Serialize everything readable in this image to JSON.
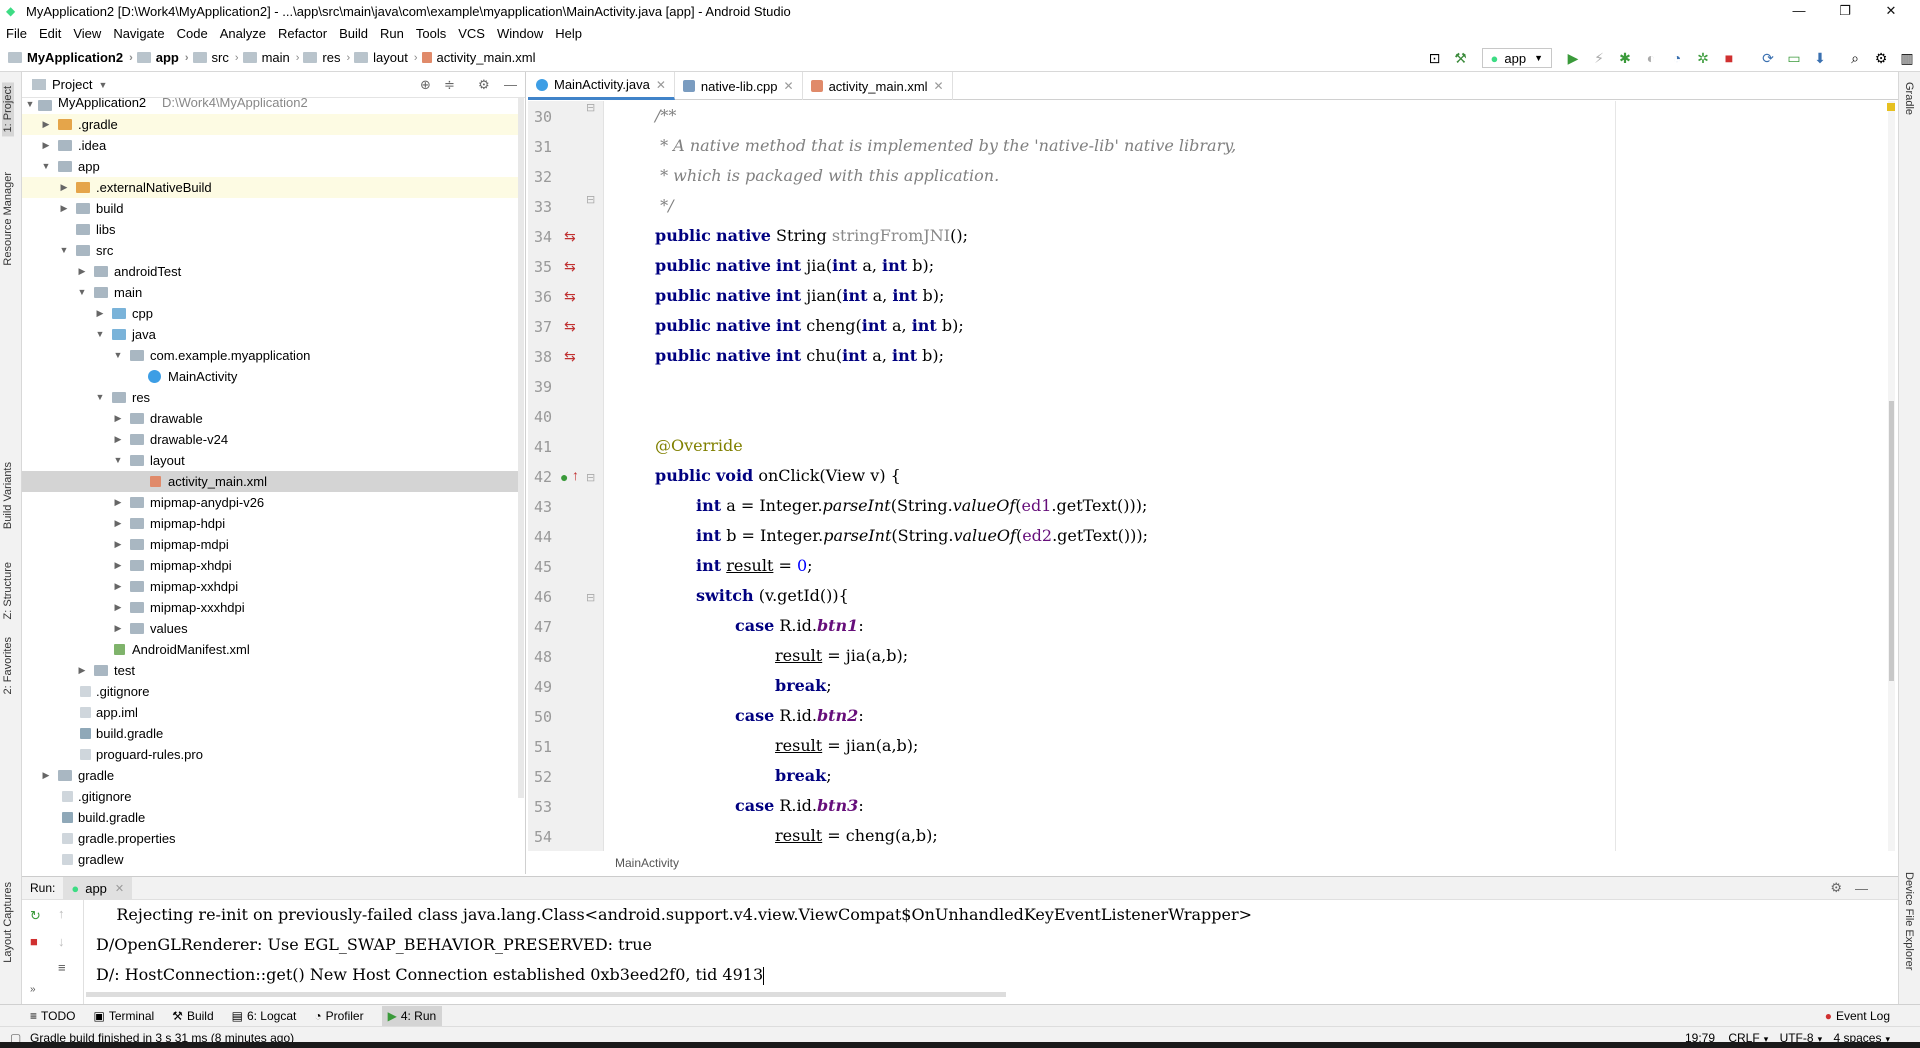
{
  "window": {
    "title": "MyApplication2 [D:\\Work4\\MyApplication2] - ...\\app\\src\\main\\java\\com\\example\\myapplication\\MainActivity.java [app] - Android Studio"
  },
  "menu": [
    "File",
    "Edit",
    "View",
    "Navigate",
    "Code",
    "Analyze",
    "Refactor",
    "Build",
    "Run",
    "Tools",
    "VCS",
    "Window",
    "Help"
  ],
  "breadcrumbs": [
    "MyApplication2",
    "app",
    "src",
    "main",
    "res",
    "layout",
    "activity_main.xml"
  ],
  "run_config": "app",
  "left_tabs": [
    "1: Project",
    "Resource Manager",
    "Build Variants",
    "Z: Structure",
    "2: Favorites",
    "Layout Captures"
  ],
  "right_tabs": [
    "Gradle",
    "Device File Explorer"
  ],
  "project": {
    "view": "Project",
    "root_label": "MyApplication2",
    "root_path": "D:\\Work4\\MyApplication2",
    "items": [
      {
        "label": ".gradle"
      },
      {
        "label": ".idea"
      },
      {
        "label": "app"
      },
      {
        "label": ".externalNativeBuild"
      },
      {
        "label": "build"
      },
      {
        "label": "libs"
      },
      {
        "label": "src"
      },
      {
        "label": "androidTest"
      },
      {
        "label": "main"
      },
      {
        "label": "cpp"
      },
      {
        "label": "java"
      },
      {
        "label": "com.example.myapplication"
      },
      {
        "label": "MainActivity"
      },
      {
        "label": "res"
      },
      {
        "label": "drawable"
      },
      {
        "label": "drawable-v24"
      },
      {
        "label": "layout"
      },
      {
        "label": "activity_main.xml"
      },
      {
        "label": "mipmap-anydpi-v26"
      },
      {
        "label": "mipmap-hdpi"
      },
      {
        "label": "mipmap-mdpi"
      },
      {
        "label": "mipmap-xhdpi"
      },
      {
        "label": "mipmap-xxhdpi"
      },
      {
        "label": "mipmap-xxxhdpi"
      },
      {
        "label": "values"
      },
      {
        "label": "AndroidManifest.xml"
      },
      {
        "label": "test"
      },
      {
        "label": ".gitignore"
      },
      {
        "label": "app.iml"
      },
      {
        "label": "build.gradle"
      },
      {
        "label": "proguard-rules.pro"
      },
      {
        "label": "gradle"
      },
      {
        "label": ".gitignore"
      },
      {
        "label": "build.gradle"
      },
      {
        "label": "gradle.properties"
      },
      {
        "label": "gradlew"
      }
    ]
  },
  "editor_tabs": [
    {
      "label": "MainActivity.java"
    },
    {
      "label": "native-lib.cpp"
    },
    {
      "label": "activity_main.xml"
    }
  ],
  "code": {
    "line_numbers": [
      "30",
      "31",
      "32",
      "33",
      "34",
      "35",
      "36",
      "37",
      "38",
      "39",
      "40",
      "41",
      "42",
      "43",
      "44",
      "45",
      "46",
      "47",
      "48",
      "49",
      "50",
      "51",
      "52",
      "53",
      "54"
    ],
    "l30": "/**",
    "l31": " * A native method that is implemented by the 'native-lib' native library,",
    "l32": " * which is packaged with this application.",
    "l33": " */",
    "kw_public": "public",
    "kw_native": "native",
    "kw_int": "int",
    "kw_void": "void",
    "kw_switch": "switch",
    "kw_case": "case",
    "kw_break": "break",
    "type_string": "String",
    "m34": "stringFromJNI",
    "m35": "jia",
    "m36": "jian",
    "m37": "cheng",
    "m38": "chu",
    "paren_empty": "();",
    "args": "(",
    "param_a": " a, ",
    "param_b": " b);",
    "annotation": "@Override",
    "m42": " onClick(View v) {",
    "int_a": " a = Integer.",
    "int_b": " b = Integer.",
    "parseInt": "parseInt",
    "strvalue": "(String.",
    "valueOf": "valueOf",
    "ed1": "ed1",
    "ed2": "ed2",
    "gettext": ".getText()));",
    "result": "result",
    "assign0": " = ",
    "zero": "0",
    "semi": ";",
    "switch_rest": " (v.getId()){",
    "rid": " R.id.",
    "btn1": "btn1",
    "btn2": "btn2",
    "btn3": "btn3",
    "colon": ":",
    "call_jia": " = jia(a,b);",
    "call_jian": " = jian(a,b);",
    "call_cheng": " = cheng(a,b);",
    "breadcrumb": "MainActivity"
  },
  "run": {
    "label": "Run:",
    "tab": "app",
    "lines": [
      "    Rejecting re-init on previously-failed class java.lang.Class<android.support.v4.view.ViewCompat$OnUnhandledKeyEventListenerWrapper>",
      "D/OpenGLRenderer: Use EGL_SWAP_BEHAVIOR_PRESERVED: true",
      "D/: HostConnection::get() New Host Connection established 0xb3eed2f0, tid 4913"
    ]
  },
  "bottom_tabs": [
    "TODO",
    "Terminal",
    "Build",
    "6: Logcat",
    "Profiler",
    "4: Run"
  ],
  "event_log": "Event Log",
  "status": {
    "message": "Gradle build finished in 3 s 31 ms (8 minutes ago)",
    "position": "19:79",
    "line_sep": "CRLF",
    "encoding": "UTF-8",
    "indent": "4 spaces"
  }
}
